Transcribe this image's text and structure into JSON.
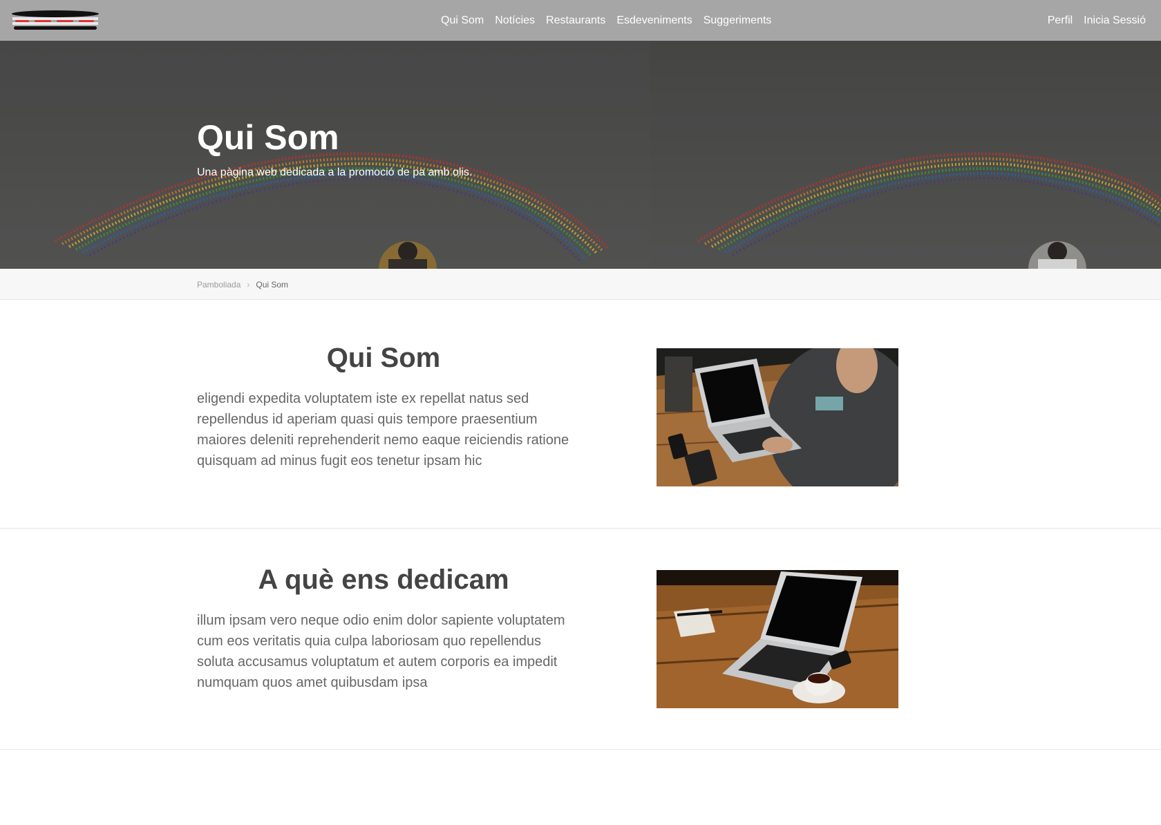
{
  "navbar": {
    "logo_name": "pamboliada-logo",
    "links": [
      "Qui Som",
      "Notícies",
      "Restaurants",
      "Esdeveniments",
      "Suggeriments"
    ],
    "right_links": [
      "Perfil",
      "Inicia Sessió"
    ]
  },
  "hero": {
    "title": "Qui Som",
    "subtitle": "Una pàgina web dedicada a la promoció de pa amb olis."
  },
  "breadcrumb": {
    "home": "Pamboliada",
    "separator": "›",
    "current": "Qui Som"
  },
  "sections": [
    {
      "title": "Qui Som",
      "body": "eligendi expedita voluptatem iste ex repellat natus sed repellendus id aperiam quasi quis tempore praesentium maiores deleniti reprehenderit nemo eaque reiciendis ratione quisquam ad minus fugit eos tenetur ipsam hic",
      "image": "person-using-laptop-photo"
    },
    {
      "title": "A què ens dedicam",
      "body": "illum ipsam vero neque odio enim dolor sapiente voluptatem cum eos veritatis quia culpa laboriosam quo repellendus soluta accusamus voluptatum et autem corporis ea impedit numquam quos amet quibusdam ipsa",
      "image": "laptop-and-coffee-photo"
    }
  ],
  "colors": {
    "navbar_bg": "#a6a6a6",
    "breadcrumb_bg": "#f7f7f7",
    "heading": "#444444",
    "body_text": "#666666"
  }
}
